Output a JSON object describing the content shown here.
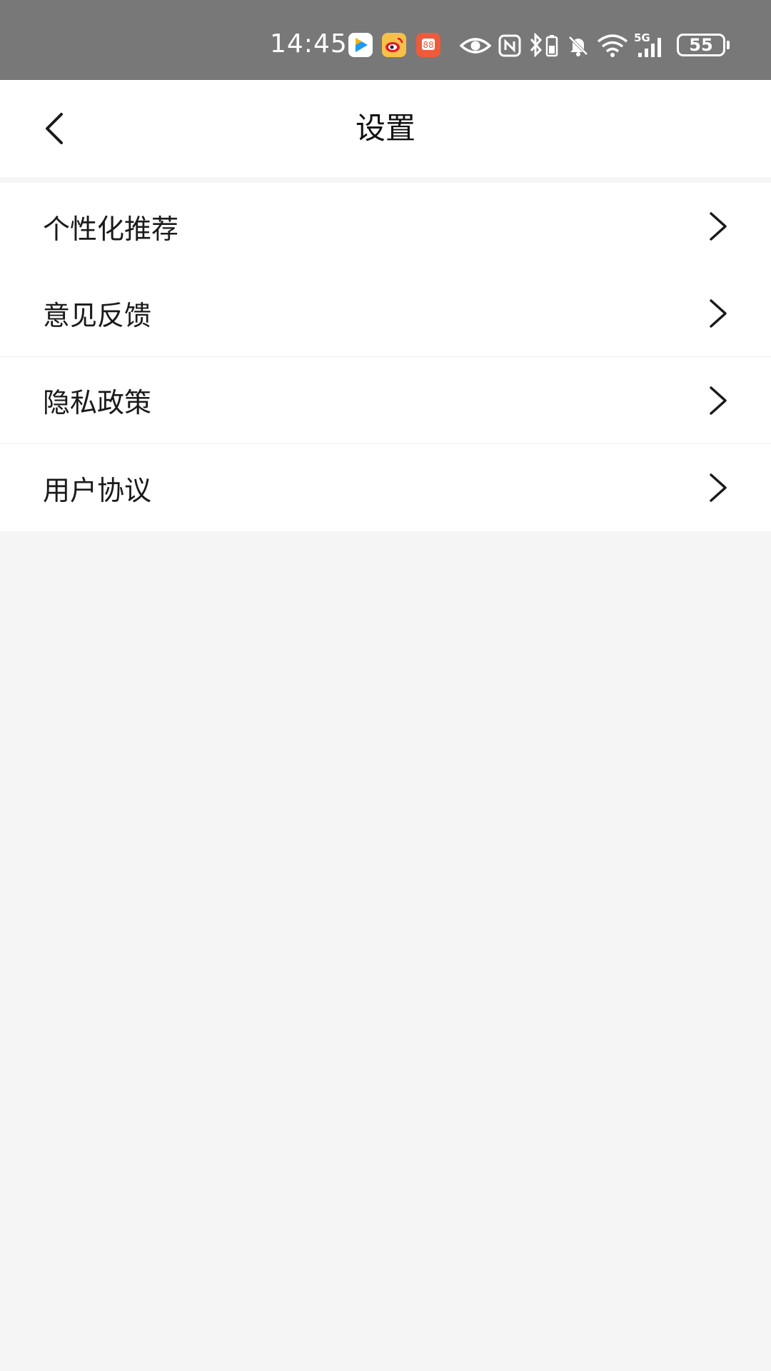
{
  "status_bar": {
    "time": "14:45",
    "battery_level": "55",
    "network": "5G",
    "background_color": "#787878"
  },
  "nav": {
    "title": "设置",
    "back_icon": "chevron-left-icon"
  },
  "settings": {
    "items": [
      {
        "label": "个性化推荐",
        "icon": "chevron-right-icon"
      },
      {
        "label": "意见反馈",
        "icon": "chevron-right-icon"
      },
      {
        "label": "隐私政策",
        "icon": "chevron-right-icon"
      },
      {
        "label": "用户协议",
        "icon": "chevron-right-icon"
      }
    ]
  },
  "colors": {
    "page_background": "#f5f5f5",
    "card_background": "#ffffff",
    "text_primary": "#1a1a1a"
  }
}
